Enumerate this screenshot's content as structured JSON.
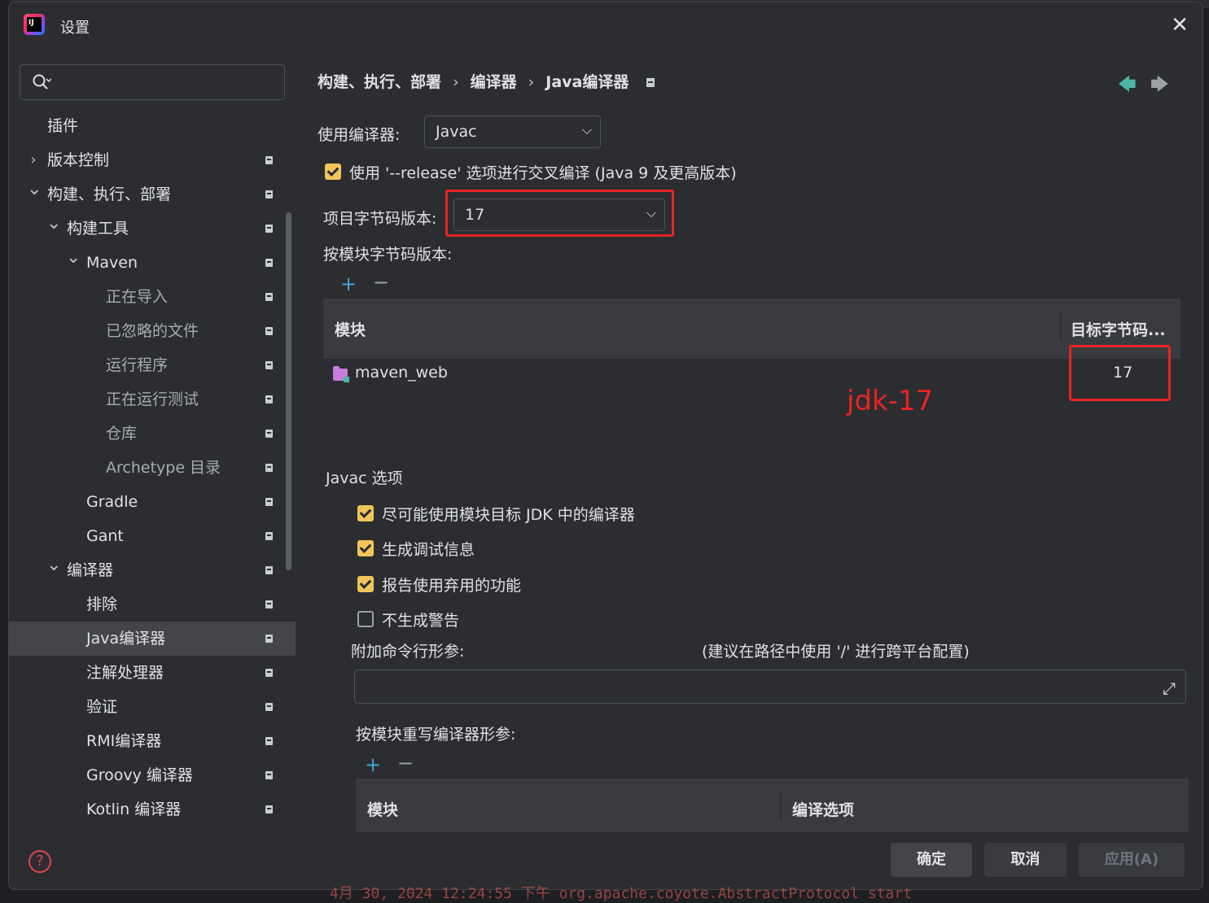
{
  "window": {
    "title": "设置"
  },
  "background": {
    "log_text": "4月 30, 2024 12:24:55 下午 org.apache.coyote.AbstractProtocol start"
  },
  "sidebar": {
    "search": {
      "placeholder": ""
    },
    "items": [
      {
        "label": "插件",
        "level": 0,
        "chevron": ""
      },
      {
        "label": "版本控制",
        "level": 0,
        "chevron": "right"
      },
      {
        "label": "构建、执行、部署",
        "level": 0,
        "chevron": "down"
      },
      {
        "label": "构建工具",
        "level": 1,
        "chevron": "down"
      },
      {
        "label": "Maven",
        "level": 2,
        "chevron": "down"
      },
      {
        "label": "正在导入",
        "level": 3
      },
      {
        "label": "已忽略的文件",
        "level": 3
      },
      {
        "label": "运行程序",
        "level": 3
      },
      {
        "label": "正在运行测试",
        "level": 3
      },
      {
        "label": "仓库",
        "level": 3
      },
      {
        "label": "Archetype 目录",
        "level": 3
      },
      {
        "label": "Gradle",
        "level": 2
      },
      {
        "label": "Gant",
        "level": 2
      },
      {
        "label": "编译器",
        "level": 1,
        "chevron": "down"
      },
      {
        "label": "排除",
        "level": 2
      },
      {
        "label": "Java编译器",
        "level": 2,
        "selected": true
      },
      {
        "label": "注解处理器",
        "level": 2
      },
      {
        "label": "验证",
        "level": 2
      },
      {
        "label": "RMI编译器",
        "level": 2
      },
      {
        "label": "Groovy 编译器",
        "level": 2
      },
      {
        "label": "Kotlin 编译器",
        "level": 2
      }
    ]
  },
  "breadcrumb": {
    "part1": "构建、执行、部署",
    "part2": "编译器",
    "part3": "Java编译器",
    "separator": "›"
  },
  "compiler": {
    "use_compiler_label": "使用编译器:",
    "use_compiler_value": "Javac",
    "release_option_label": "使用 '--release' 选项进行交叉编译 (Java 9 及更高版本)",
    "release_option_checked": true,
    "project_bytecode_label": "项目字节码版本:",
    "project_bytecode_value": "17",
    "per_module_label": "按模块字节码版本:"
  },
  "module_table": {
    "col_module": "模块",
    "col_target": "目标字节码...",
    "rows": [
      {
        "module": "maven_web",
        "target": "17"
      }
    ]
  },
  "annotation": {
    "text": "jdk-17"
  },
  "javac": {
    "section_title": "Javac 选项",
    "options": [
      {
        "label": "尽可能使用模块目标 JDK 中的编译器",
        "checked": true
      },
      {
        "label": "生成调试信息",
        "checked": true
      },
      {
        "label": "报告使用弃用的功能",
        "checked": true
      },
      {
        "label": "不生成警告",
        "checked": false
      }
    ],
    "extra_args_label": "附加命令行形参:",
    "extra_args_hint": "(建议在路径中使用 '/' 进行跨平台配置)",
    "extra_args_value": "",
    "override_label": "按模块重写编译器形参:",
    "override_col_module": "模块",
    "override_col_options": "编译选项"
  },
  "footer": {
    "ok": "确定",
    "cancel": "取消",
    "apply": "应用(A)"
  },
  "colors": {
    "accent_check": "#f2c55c",
    "annotation_red": "#e82424",
    "background": "#2b2d30"
  }
}
